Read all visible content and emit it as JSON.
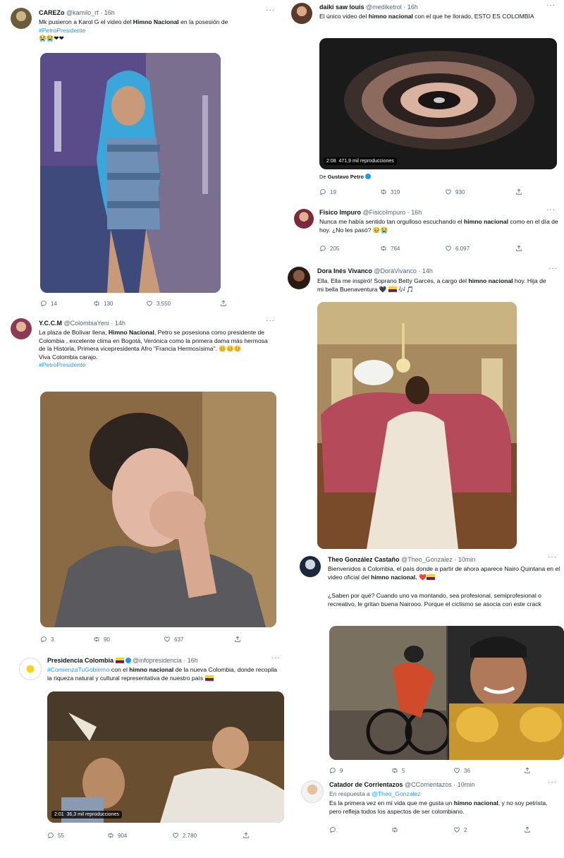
{
  "tweets": [
    {
      "name": "CAREZo",
      "handle": "@kamilo_rf",
      "time": "· 16h",
      "text_a": "Mk pusieron a Karol G el video del ",
      "text_kw": "Himno Nacional",
      "text_b": " en la posesión de",
      "tag": "#PetroPresidente",
      "emojis": "😭😭❤❤",
      "replies": "14",
      "retweets": "130",
      "likes": "3.550"
    },
    {
      "name": "daiki saw louis",
      "handle": "@mediketrol",
      "time": "· 16h",
      "text_a": "El único video del ",
      "text_kw": "himno nacional",
      "text_b": " con el que he llorado, ESTO ES COLOMBIA",
      "video_time": "2:08",
      "video_views": "471,9 mil reproducciones",
      "from_label": "De",
      "from_name": "Gustavo Petro",
      "replies": "19",
      "retweets": "319",
      "likes": "930"
    },
    {
      "name": "Fisico Impuro",
      "handle": "@FisicoImpuro",
      "time": "· 16h",
      "text_a": "Nunca me había sentido tan orgulloso escuchando el ",
      "text_kw": "himno nacional",
      "text_b": " como en el día de hoy. ¿No les pasó? 🥹😭",
      "replies": "205",
      "retweets": "764",
      "likes": "6.097"
    },
    {
      "name": "Dora Inés Vivanco",
      "handle": "@DoraVivanco",
      "time": "· 14h",
      "text_a": "Ella. Ella me inspiró! Soprano Betty Garcés, a cargo del ",
      "text_kw": "himno nacional",
      "text_b": " hoy. Hija de mi bella Buenaventura 🖤",
      "tail": "🎶🎵"
    },
    {
      "name": "Y.C.C.M",
      "handle": "@ColombiaYeni",
      "time": "· 14h",
      "text_a": "La plaza de Bolívar llena, ",
      "text_kw": "Himno Nacional",
      "text_b": ", Petro se posesiona como presidente de Colombia , excelente clima en Bogotá, Verónica como la primera dama más hermosa de la Historia, Primera vicepresidenta Afro \"Francia Hermosísima\". 😊😊😊",
      "line2": "Viva Colombia carajo.",
      "tag": "#PetroPresidente",
      "replies": "3",
      "retweets": "90",
      "likes": "637"
    },
    {
      "name": "Theo González Castaño",
      "handle": "@Theo_Gonzalez",
      "time": "· 10min",
      "text_a": "Bienvenidos a Colombia, el país donde a partir de ahora aparece Nairo Quintana en el video oficial del ",
      "text_kw": "himno nacional.",
      "text_b": " ❤️",
      "para2": "¿Saben por qué? Cuando uno va montando, sea profesional, semiprofesional o recreativo, le gritan buena Nairooo. Porque el ciclismo se asocia con este crack",
      "replies": "9",
      "retweets": "5",
      "likes": "36"
    },
    {
      "name": "Presidencia Colombia",
      "handle": "@infopresidencia",
      "time": "· 16h",
      "tag": "#ComienzaTuGobierno",
      "text_a": " con el ",
      "text_kw": "himno nacional",
      "text_b": " de la nueva Colombia, donde recopila la riqueza natural y cultural representativa de nuestro país",
      "video_time": "2:01",
      "video_views": "36,3 mil reproducciones",
      "replies": "55",
      "retweets": "904",
      "likes": "2.780"
    },
    {
      "name": "Catador de Corrientazos",
      "handle": "@CCorrientazos",
      "time": "· 10min",
      "reply_label": "En respuesta a",
      "reply_to": "@Theo_Gonzalez",
      "text_a": "Es la primera vez en mi vida que me gusta un ",
      "text_kw": "himno nacional",
      "text_b": ", y no soy petrista, pero refleja todos los aspectos de ser colombiano.",
      "likes": "2"
    }
  ],
  "colors": {
    "accent": "#1d9bf0",
    "text": "#0f1419",
    "muted": "#536471"
  },
  "icons": [
    "reply-icon",
    "retweet-icon",
    "like-icon",
    "share-icon",
    "more-icon",
    "verified-icon"
  ]
}
